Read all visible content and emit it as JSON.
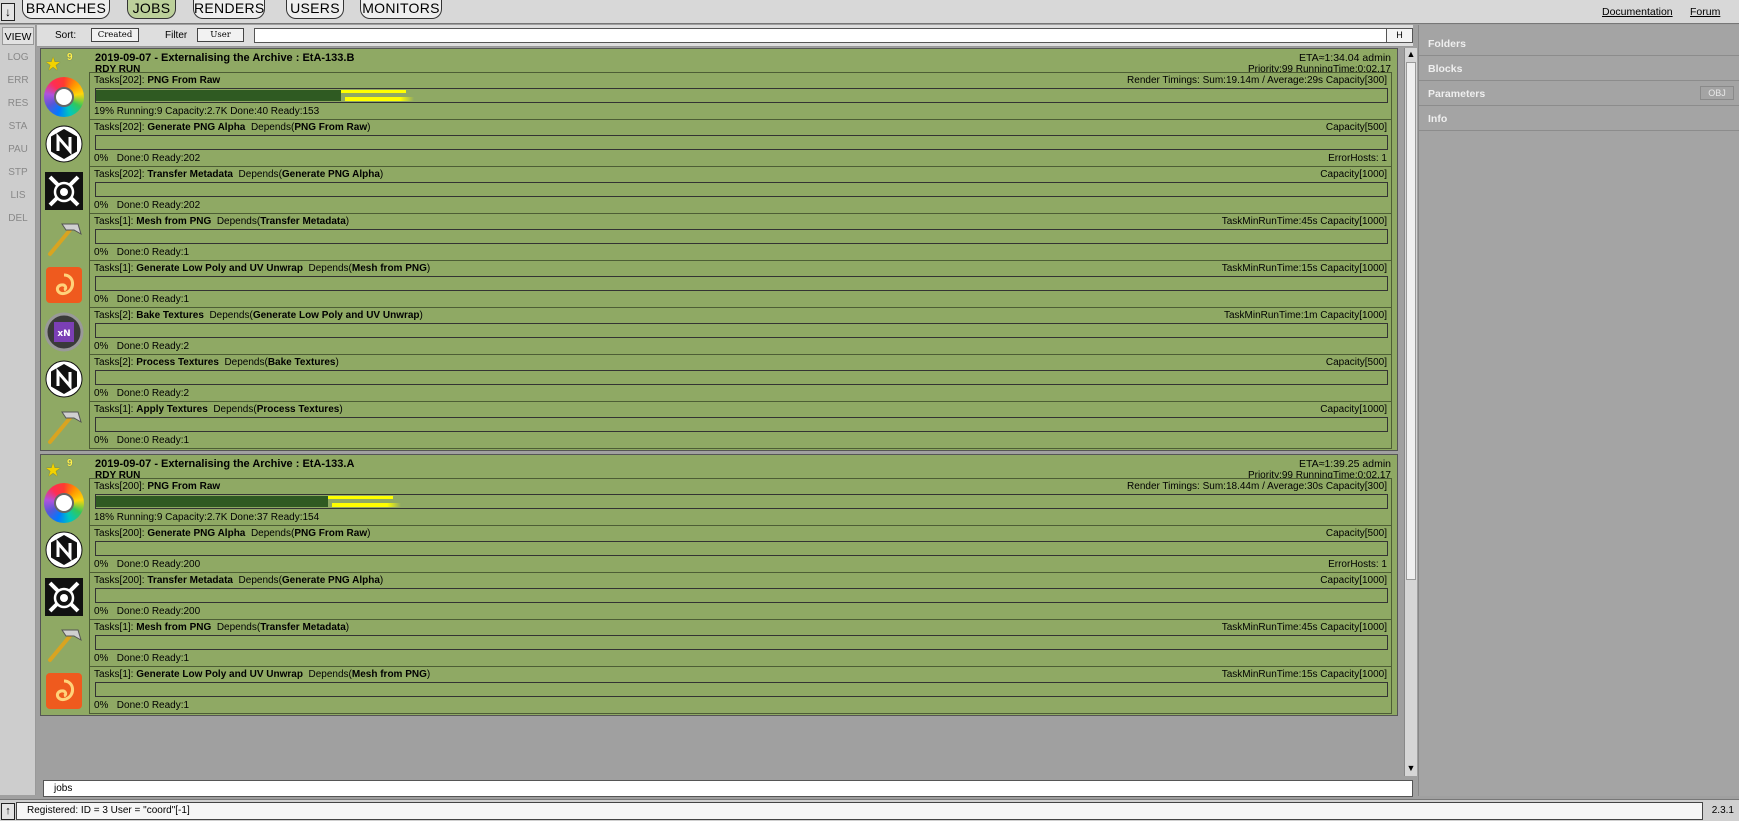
{
  "topnav": {
    "menu_glyph": "↓",
    "tabs": [
      {
        "label": "BRANCHES",
        "active": false
      },
      {
        "label": "JOBS",
        "active": true
      },
      {
        "label": "RENDERS",
        "active": false
      },
      {
        "label": "USERS",
        "active": false
      },
      {
        "label": "MONITORS",
        "active": false
      }
    ],
    "links": [
      "Documentation",
      "Forum"
    ]
  },
  "actions": [
    "VIEW",
    "LOG",
    "ERR",
    "RES",
    "STA",
    "PAU",
    "STP",
    "LIS",
    "DEL"
  ],
  "sortbar": {
    "sort_label": "Sort:",
    "sort_value": "Created",
    "filter_label": "Filter",
    "filter_value": "User",
    "filter_text": "",
    "h_button": "H"
  },
  "jobs": [
    {
      "priority_badge": "9",
      "title": "2019-09-07 - Externalising the Archive : EtA-133.B",
      "state": "RDY RUN",
      "eta": "ETA≈1:34.04 admin",
      "priority": "Priority:99 RunningTime:0:02.17",
      "tasks": [
        {
          "icon": "color-wheel-icon",
          "count": "Tasks[202]:",
          "name": "PNG From Raw",
          "depends": "",
          "right": "Render Timings: Sum:19.14m / Average:29s Capacity[300]",
          "stats": "19% Running:9 Capacity:2.7K Done:40 Ready:153",
          "error": "",
          "progress": 0.19,
          "running": 0.05
        },
        {
          "icon": "nuke-hex-icon",
          "count": "Tasks[202]:",
          "name": "Generate PNG Alpha",
          "depends": "PNG From Raw",
          "right": "Capacity[500]",
          "stats": "0%   Done:0 Ready:202",
          "error": "ErrorHosts: 1",
          "progress": 0,
          "running": 0
        },
        {
          "icon": "camera-tools-icon",
          "count": "Tasks[202]:",
          "name": "Transfer Metadata",
          "depends": "Generate PNG Alpha",
          "right": "Capacity[1000]",
          "stats": "0%   Done:0 Ready:202",
          "error": "",
          "progress": 0,
          "running": 0
        },
        {
          "icon": "hammer-icon",
          "count": "Tasks[1]:",
          "name": "Mesh from PNG",
          "depends": "Transfer Metadata",
          "right": "TaskMinRunTime:45s Capacity[1000]",
          "stats": "0%   Done:0 Ready:1",
          "error": "",
          "progress": 0,
          "running": 0
        },
        {
          "icon": "houdini-icon",
          "count": "Tasks[1]:",
          "name": "Generate Low Poly and UV Unwrap",
          "depends": "Mesh from PNG",
          "right": "TaskMinRunTime:15s Capacity[1000]",
          "stats": "0%   Done:0 Ready:1",
          "error": "",
          "progress": 0,
          "running": 0
        },
        {
          "icon": "xnormal-icon",
          "count": "Tasks[2]:",
          "name": "Bake Textures",
          "depends": "Generate Low Poly and UV Unwrap",
          "right": "TaskMinRunTime:1m Capacity[1000]",
          "stats": "0%   Done:0 Ready:2",
          "error": "",
          "progress": 0,
          "running": 0
        },
        {
          "icon": "nuke-hex-icon",
          "count": "Tasks[2]:",
          "name": "Process Textures",
          "depends": "Bake Textures",
          "right": "Capacity[500]",
          "stats": "0%   Done:0 Ready:2",
          "error": "",
          "progress": 0,
          "running": 0
        },
        {
          "icon": "hammer-icon",
          "count": "Tasks[1]:",
          "name": "Apply Textures",
          "depends": "Process Textures",
          "right": "Capacity[1000]",
          "stats": "0%   Done:0 Ready:1",
          "error": "",
          "progress": 0,
          "running": 0
        }
      ]
    },
    {
      "priority_badge": "9",
      "title": "2019-09-07 - Externalising the Archive : EtA-133.A",
      "state": "RDY RUN",
      "eta": "ETA≈1:39.25 admin",
      "priority": "Priority:99 RunningTime:0:02.17",
      "tasks": [
        {
          "icon": "color-wheel-icon",
          "count": "Tasks[200]:",
          "name": "PNG From Raw",
          "depends": "",
          "right": "Render Timings: Sum:18.44m / Average:30s Capacity[300]",
          "stats": "18% Running:9 Capacity:2.7K Done:37 Ready:154",
          "error": "",
          "progress": 0.18,
          "running": 0.05
        },
        {
          "icon": "nuke-hex-icon",
          "count": "Tasks[200]:",
          "name": "Generate PNG Alpha",
          "depends": "PNG From Raw",
          "right": "Capacity[500]",
          "stats": "0%   Done:0 Ready:200",
          "error": "ErrorHosts: 1",
          "progress": 0,
          "running": 0
        },
        {
          "icon": "camera-tools-icon",
          "count": "Tasks[200]:",
          "name": "Transfer Metadata",
          "depends": "Generate PNG Alpha",
          "right": "Capacity[1000]",
          "stats": "0%   Done:0 Ready:200",
          "error": "",
          "progress": 0,
          "running": 0
        },
        {
          "icon": "hammer-icon",
          "count": "Tasks[1]:",
          "name": "Mesh from PNG",
          "depends": "Transfer Metadata",
          "right": "TaskMinRunTime:45s Capacity[1000]",
          "stats": "0%   Done:0 Ready:1",
          "error": "",
          "progress": 0,
          "running": 0
        },
        {
          "icon": "houdini-icon",
          "count": "Tasks[1]:",
          "name": "Generate Low Poly and UV Unwrap",
          "depends": "Mesh from PNG",
          "right": "TaskMinRunTime:15s Capacity[1000]",
          "stats": "0%   Done:0 Ready:1",
          "error": "",
          "progress": 0,
          "running": 0
        }
      ]
    }
  ],
  "depends_label": "Depends",
  "jobs_input": "jobs",
  "rightpanel": {
    "sections": [
      "Folders",
      "Blocks",
      "Parameters",
      "Info"
    ],
    "obj_button": "OBJ"
  },
  "status": {
    "menu_glyph": "↑",
    "message": "Registered: ID = 3 User = \"coord\"[-1]",
    "version": "2.3.1"
  },
  "colors": {
    "job_bg": "#8fa964",
    "progress_done": "#2f5a22",
    "progress_running": "#ffff00",
    "active_tab": "#bcd09a"
  }
}
